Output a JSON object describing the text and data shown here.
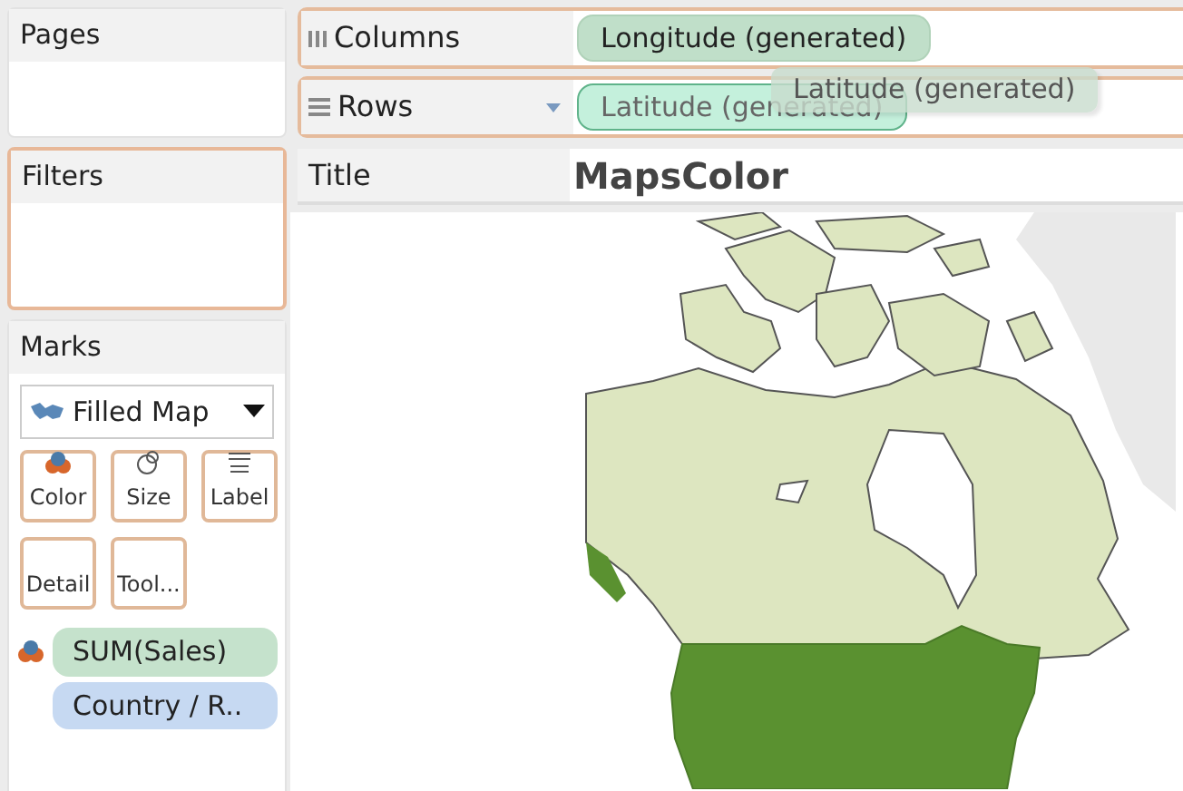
{
  "cards": [
    {
      "title": "Pages",
      "highlighted": false
    },
    {
      "title": "Filters",
      "highlighted": true
    }
  ],
  "marks": {
    "title": "Marks",
    "mark_type": "Filled Map",
    "buttons": [
      {
        "label": "Color",
        "kind": "color"
      },
      {
        "label": "Size",
        "kind": "size"
      },
      {
        "label": "Label",
        "kind": "label"
      },
      {
        "label": "Detail",
        "kind": "detail"
      },
      {
        "label": "Tool...",
        "kind": "tooltip"
      }
    ],
    "pills": [
      {
        "label": "SUM(Sales)",
        "kind": "color",
        "continuous": true
      },
      {
        "label": "Country / R..",
        "kind": "detail",
        "continuous": false
      }
    ]
  },
  "shelves": [
    {
      "label": "Columns",
      "kind": "columns",
      "dropdown": false,
      "pills": [
        {
          "label": "Longitude (generated)",
          "highlighted": false
        }
      ]
    },
    {
      "label": "Rows",
      "kind": "rows",
      "dropdown": true,
      "pills": [
        {
          "label": "Latitude (generated)",
          "highlighted": true
        }
      ]
    }
  ],
  "drag_pill": {
    "label": "Latitude (generated)"
  },
  "title_row": {
    "label": "Title",
    "value": "MapsColor"
  }
}
